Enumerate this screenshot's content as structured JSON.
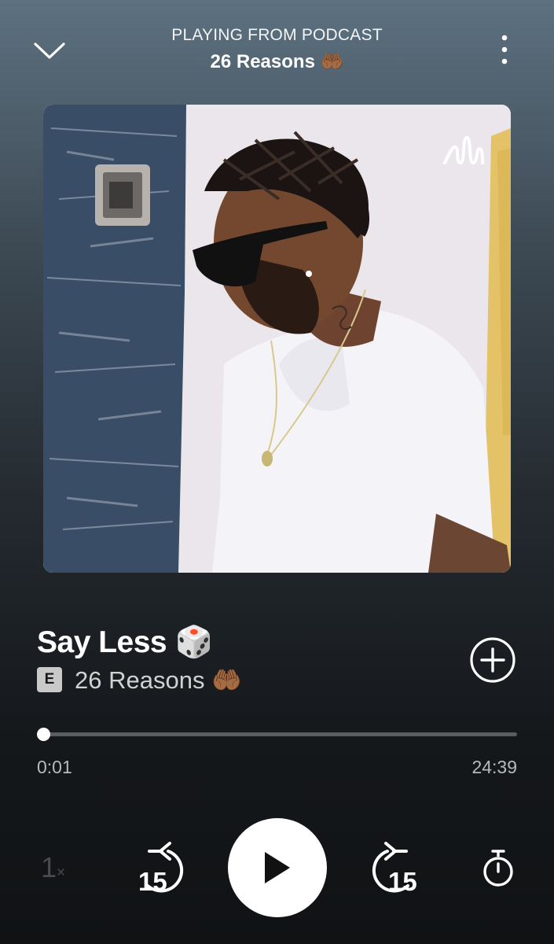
{
  "header": {
    "context_label": "PLAYING FROM PODCAST",
    "podcast_title": "26 Reasons 🤲🏾"
  },
  "episode": {
    "title": "Say Less 🎲",
    "explicit_badge": "E",
    "podcast_name": "26 Reasons 🤲🏾"
  },
  "progress": {
    "elapsed": "0:01",
    "total": "24:39",
    "fraction": 0.001
  },
  "controls": {
    "speed": "1",
    "speed_suffix": "×",
    "skip_back_seconds": "15",
    "skip_forward_seconds": "15"
  },
  "colors": {
    "background_top": "#5d7180",
    "background_bottom": "#101214",
    "progress_fill": "#ffffff",
    "progress_track": "#5b5e60"
  },
  "icons": {
    "collapse": "chevron-down-icon",
    "more": "more-vertical-icon",
    "add": "add-circle-icon",
    "play": "play-icon",
    "skip_back": "skip-back-15-icon",
    "skip_forward": "skip-forward-15-icon",
    "sleep_timer": "timer-icon",
    "podcast_logo": "anchor-logo-icon"
  }
}
